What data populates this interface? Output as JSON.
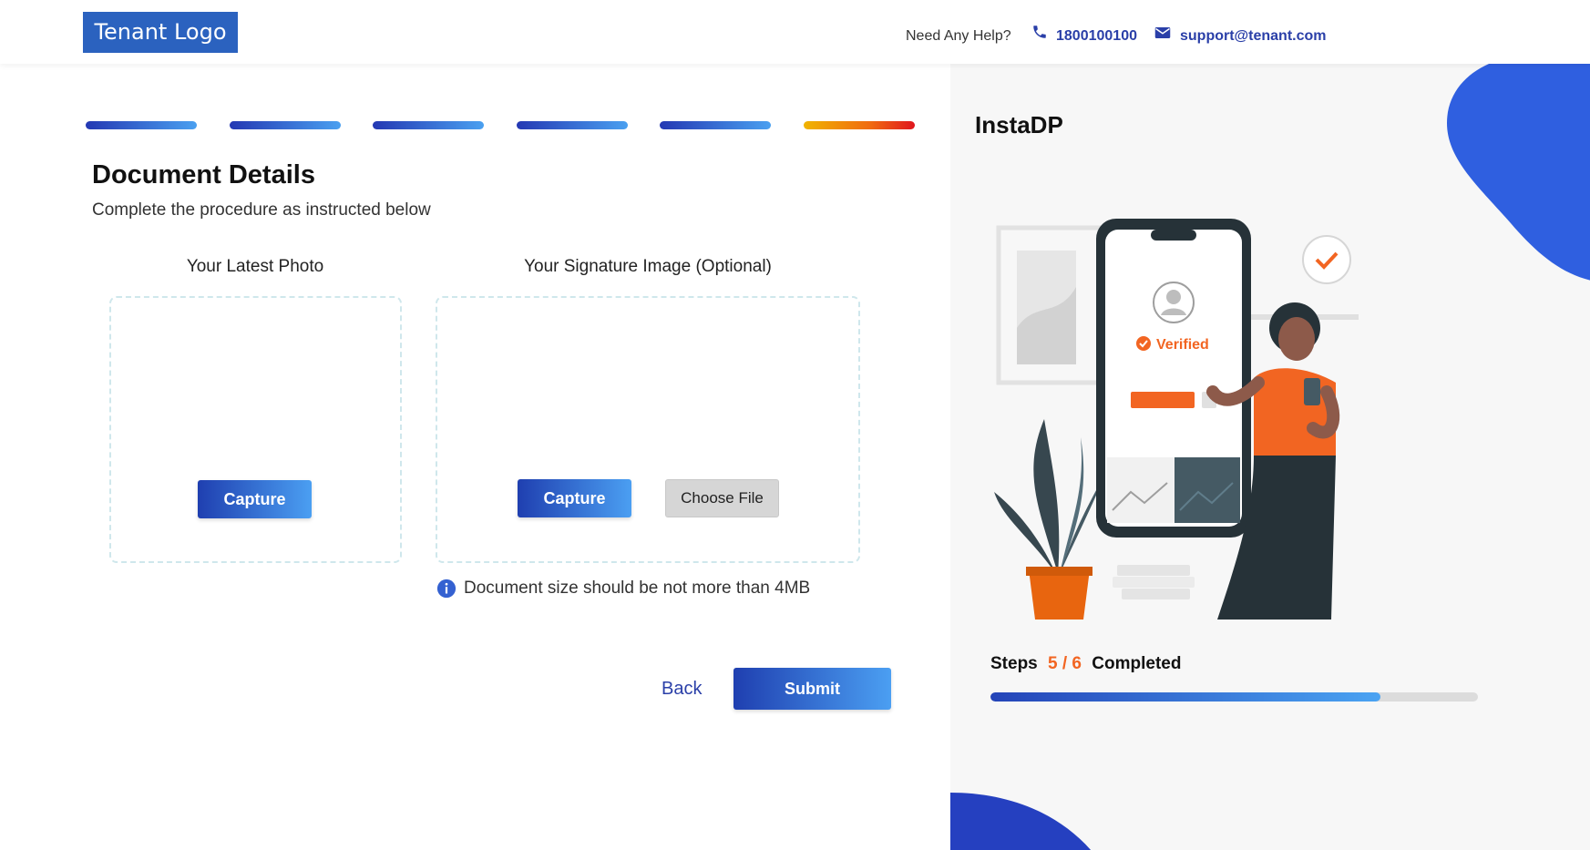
{
  "header": {
    "logo_text": "Tenant Logo",
    "help_text": "Need Any Help?",
    "phone_icon": "phone-icon",
    "phone": "1800100100",
    "mail_icon": "mail-icon",
    "email": "support@tenant.com"
  },
  "stepper": {
    "total": 6,
    "current": 6,
    "completed_color": "#2438b3",
    "active_color": "#f06a10"
  },
  "form": {
    "title": "Document Details",
    "subtitle": "Complete the procedure as instructed below",
    "photo": {
      "label": "Your Latest Photo",
      "capture_label": "Capture"
    },
    "signature": {
      "label": "Your Signature Image (Optional)",
      "capture_label": "Capture",
      "choose_file_label": "Choose File"
    },
    "info_icon": "info-icon",
    "info_text": "Document size should be not more than 4MB",
    "back_label": "Back",
    "submit_label": "Submit"
  },
  "sidebar": {
    "app_title": "InstaDP",
    "illustration_badge": "Verified",
    "steps": {
      "prefix": "Steps",
      "completed": 5,
      "total": 6,
      "fraction_text": "5 / 6",
      "suffix": "Completed",
      "progress_fraction": 0.8
    },
    "accent_color": "#2c4fd0",
    "highlight_color": "#f26522"
  }
}
